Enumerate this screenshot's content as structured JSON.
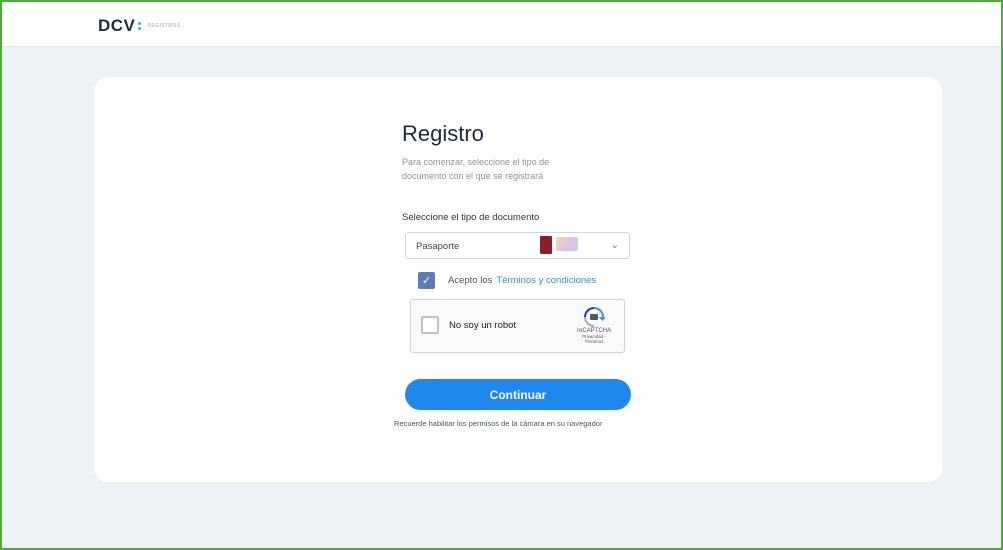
{
  "header": {
    "logo_text": "DCV",
    "logo_tag": "REGISTROS",
    "accent_color": "#49b7a5"
  },
  "form": {
    "title": "Registro",
    "subtitle": "Para comenzar, seleccione el tipo de documento con el que se registrará",
    "field_label": "Seleccione el tipo de documento",
    "document_type": {
      "selected": "Pasaporte",
      "icons": [
        "passport-icon",
        "id-card-icon"
      ]
    },
    "terms": {
      "checked": true,
      "text": "Acepto los",
      "link": "Términos y condiciones"
    },
    "recaptcha": {
      "label": "No soy un robot",
      "brand": "reCAPTCHA",
      "links": "Privacidad - Términos"
    },
    "continue_label": "Continuar",
    "hint": "Recuerde habilitar los permisos de la cámara en su navegador",
    "primary_color": "#1f88ee"
  }
}
